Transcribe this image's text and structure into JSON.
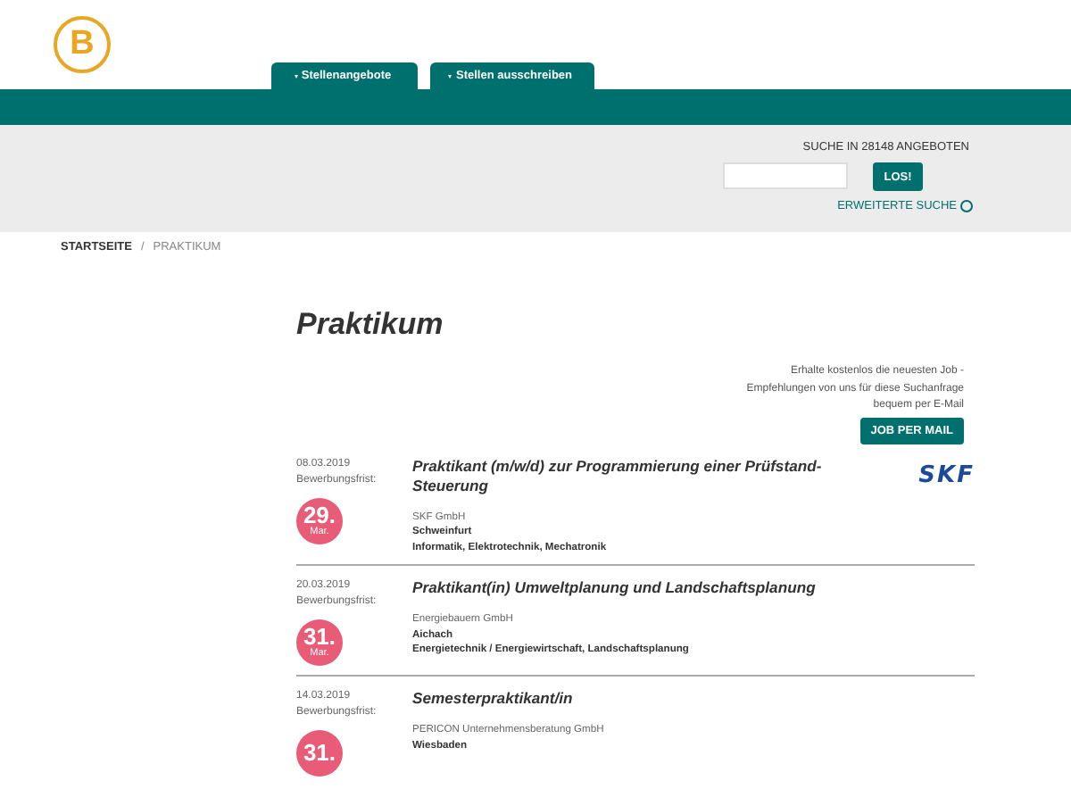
{
  "logo": {
    "letter": "B"
  },
  "tabs": [
    {
      "label": "Stellenangebote"
    },
    {
      "label": "Stellen ausschreiben"
    }
  ],
  "search": {
    "heading": "SUCHE IN 28148 ANGEBOTEN",
    "button": "LOS!",
    "advanced_link": "ERWEITERTE SUCHE"
  },
  "breadcrumb": [
    {
      "label": "STARTSEITE",
      "current": false
    },
    {
      "label": "PRAKTIKUM",
      "current": true
    }
  ],
  "breadcrumb_separator": "/",
  "page_title": "Praktikum",
  "mail_promo": {
    "text": "Erhalte kostenlos die neuesten Job - Empfehlungen von uns für diese Suchanfrage bequem per E-Mail",
    "button": "JOB PER MAIL"
  },
  "jobs": [
    {
      "date": "08.03.2019",
      "deadline_label": "Bewerbungsfrist:",
      "deadline_day": "29.",
      "deadline_month": "Mar.",
      "title": "Praktikant (m/w/d) zur Programmierung einer Prüfstand-Steuerung",
      "company": "SKF GmbH",
      "location": "Schweinfurt",
      "fields": "Informatik, Elektrotechnik, Mechatronik",
      "company_logo": "SKF"
    },
    {
      "date": "20.03.2019",
      "deadline_label": "Bewerbungsfrist:",
      "deadline_day": "31.",
      "deadline_month": "Mar.",
      "title": "Praktikant(in) Umweltplanung und Landschaftsplanung",
      "company": "Energiebauern GmbH",
      "location": "Aichach",
      "fields": "Energietechnik / Energiewirtschaft, Landschaftsplanung"
    },
    {
      "date": "14.03.2019",
      "deadline_label": "Bewerbungsfrist:",
      "deadline_day": "31.",
      "title": "Semesterpraktikant/in",
      "company": "PERICON Unternehmensberatung GmbH",
      "location": "Wiesbaden"
    }
  ]
}
